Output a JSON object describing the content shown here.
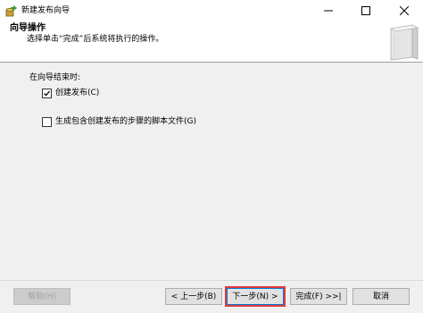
{
  "window": {
    "title": "新建发布向导"
  },
  "header": {
    "title": "向导操作",
    "subtitle": "选择单击“完成”后系统将执行的操作。"
  },
  "body": {
    "group_label": "在向导结束时:",
    "options": [
      {
        "label": "创建发布(C)",
        "checked": true
      },
      {
        "label": "生成包含创建发布的步骤的脚本文件(G)",
        "checked": false
      }
    ]
  },
  "footer": {
    "help_label": "帮助(H)",
    "back_label": "< 上一步(B)",
    "next_label": "下一步(N) >",
    "finish_label": "完成(F) >>|",
    "cancel_label": "取消"
  },
  "icons": {
    "app": "database-publication-icon",
    "header_graphic": "wizard-book-icon"
  },
  "colors": {
    "highlight": "#e23b3b",
    "body_background": "#f0f0f0"
  }
}
